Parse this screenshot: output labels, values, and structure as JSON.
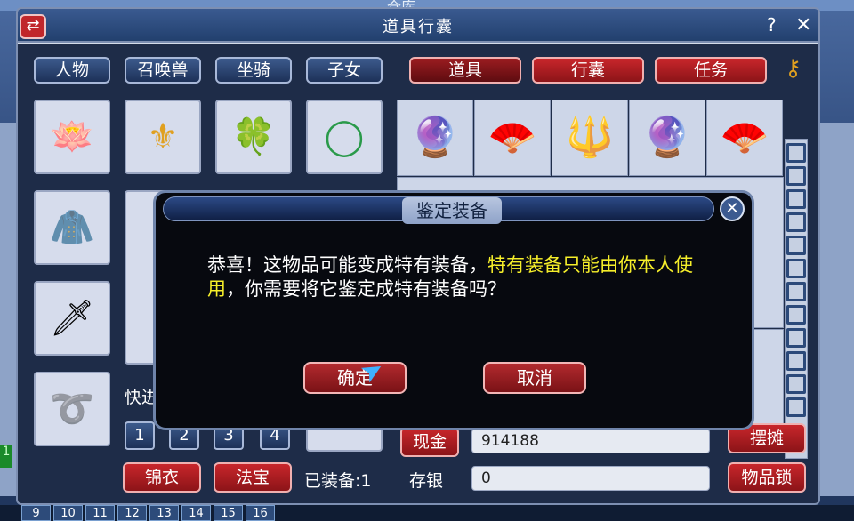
{
  "background": {
    "top_title": "仓库",
    "page_numbers": [
      "9",
      "10",
      "11",
      "12",
      "13",
      "14",
      "15",
      "16"
    ],
    "left_badge": "1"
  },
  "window": {
    "title": "道具行囊",
    "help_label": "?",
    "close_label": "✕",
    "swap_label": "⇄"
  },
  "tabs_left": [
    "人物",
    "召唤兽",
    "坐骑",
    "子女"
  ],
  "tabs_right": [
    "道具",
    "行囊",
    "任务"
  ],
  "active_right_tab": "道具",
  "equip_slots": {
    "row1": [
      {
        "icon": "lotus-icon",
        "glyph": "🪷"
      },
      {
        "icon": "earring-icon",
        "glyph": "⚜"
      },
      {
        "icon": "jade-pendant-icon",
        "glyph": "🍀"
      },
      {
        "icon": "jade-bracelet-icon",
        "glyph": "◯"
      }
    ],
    "col": [
      {
        "icon": "cloak-silhouette-icon",
        "glyph": "🧥"
      },
      {
        "icon": "spear-icon",
        "glyph": "🗡"
      },
      {
        "icon": "belt-silhouette-icon",
        "glyph": "➰"
      }
    ]
  },
  "inventory_row1": [
    {
      "icon": "orb-wand-icon",
      "glyph": "🔮"
    },
    {
      "icon": "golden-fan-icon",
      "glyph": "🪭"
    },
    {
      "icon": "jade-mace-icon",
      "glyph": "🔱"
    },
    {
      "icon": "orb-wand-icon",
      "glyph": "🔮"
    },
    {
      "icon": "golden-fan-icon",
      "glyph": "🪭"
    }
  ],
  "quick_label": "快进",
  "page_buttons": [
    "1",
    "2",
    "3",
    "4"
  ],
  "bottom": {
    "cash_label": "现金",
    "cash_value": "914188",
    "stall_label": "摆摊",
    "wardrobe_label": "锦衣",
    "treasure_label": "法宝",
    "equipped_label": "已装备:1",
    "savings_label": "存银",
    "savings_value": "0",
    "item_lock_label": "物品锁"
  },
  "dialog": {
    "title": "鉴定装备",
    "text_prefix": "恭喜！这物品可能变成特有装备，",
    "text_highlight": "特有装备只能由你本人使用",
    "text_suffix": "，你需要将它鉴定成特有装备吗？",
    "highlight_color": "#f6ef2a",
    "confirm_label": "确定",
    "cancel_label": "取消",
    "close_label": "✕"
  }
}
